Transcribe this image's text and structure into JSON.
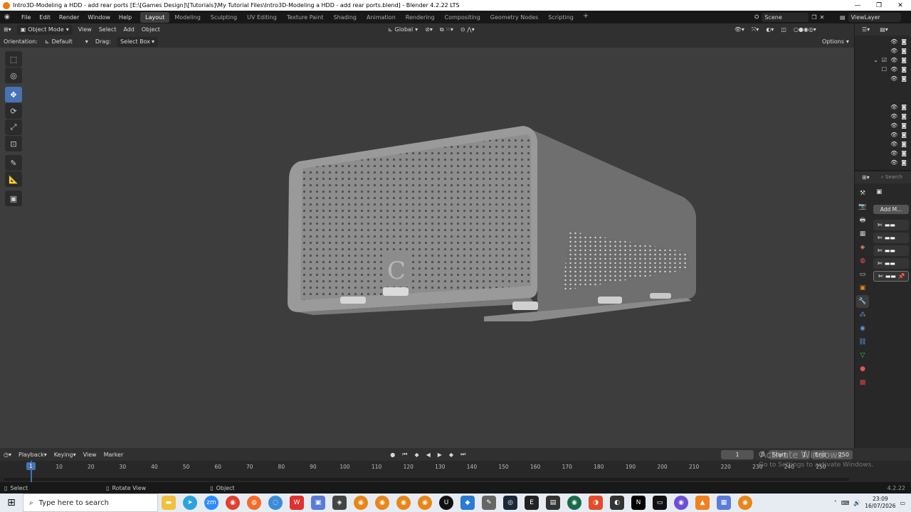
{
  "window": {
    "title": "Intro3D-Modeling a HDD - add rear ports [E:\\[Games Design]\\[Tutorials]\\My Tutorial Files\\Intro3D-Modeling a HDD - add rear ports.blend] - Blender 4.2.22 LTS",
    "controls": [
      "—",
      "❐",
      "✕"
    ]
  },
  "menu": [
    "File",
    "Edit",
    "Render",
    "Window",
    "Help"
  ],
  "workspaces": [
    {
      "label": "Layout",
      "active": true
    },
    {
      "label": "Modeling"
    },
    {
      "label": "Sculpting"
    },
    {
      "label": "UV Editing"
    },
    {
      "label": "Texture Paint"
    },
    {
      "label": "Shading"
    },
    {
      "label": "Animation"
    },
    {
      "label": "Rendering"
    },
    {
      "label": "Compositing"
    },
    {
      "label": "Geometry Nodes"
    },
    {
      "label": "Scripting"
    }
  ],
  "scene": {
    "label": "Scene"
  },
  "view_layer": {
    "label": "ViewLayer"
  },
  "viewport_header": {
    "mode": "Object Mode",
    "menus": [
      "View",
      "Select",
      "Add",
      "Object"
    ],
    "transform": "Global"
  },
  "tool_header": {
    "orientation_label": "Orientation:",
    "orientation_value": "Default",
    "drag_label": "Drag:",
    "drag_value": "Select Box",
    "options": "Options"
  },
  "tools": [
    {
      "name": "select-box-tool-icon",
      "glyph": "⬚"
    },
    {
      "name": "cursor-tool-icon",
      "glyph": "◎"
    },
    {
      "name": "move-tool-icon",
      "glyph": "✥",
      "active": true
    },
    {
      "name": "rotate-tool-icon",
      "glyph": "⟳"
    },
    {
      "name": "scale-tool-icon",
      "glyph": "⤢"
    },
    {
      "name": "transform-tool-icon",
      "glyph": "⊡"
    },
    {
      "name": "annotate-tool-icon",
      "glyph": "✎"
    },
    {
      "name": "measure-tool-icon",
      "glyph": "📐"
    },
    {
      "name": "add-cube-tool-icon",
      "glyph": "▣"
    }
  ],
  "properties": {
    "add_modifier": "Add M...",
    "search_placeholder": "Search"
  },
  "timeline": {
    "menus": [
      "Playback",
      "Keying",
      "View",
      "Marker"
    ],
    "current_frame": "1",
    "start_label": "Start",
    "start_value": "1",
    "end_label": "End",
    "end_value": "250",
    "ruler": [
      "10",
      "20",
      "30",
      "40",
      "50",
      "60",
      "70",
      "80",
      "90",
      "100",
      "110",
      "120",
      "130",
      "140",
      "150",
      "160",
      "170",
      "180",
      "190",
      "200",
      "210",
      "220",
      "230",
      "240",
      "250"
    ]
  },
  "statusbar": {
    "select": "Select",
    "rotate": "Rotate View",
    "object": "Object",
    "version": "4.2.22"
  },
  "watermark": {
    "line1": "Activate Windows",
    "line2": "Go to Settings to activate Windows."
  },
  "model": {
    "logo_letter": "C"
  },
  "taskbar": {
    "search_placeholder": "Type here to search",
    "time": "23:09",
    "date": "16/07/2026"
  }
}
